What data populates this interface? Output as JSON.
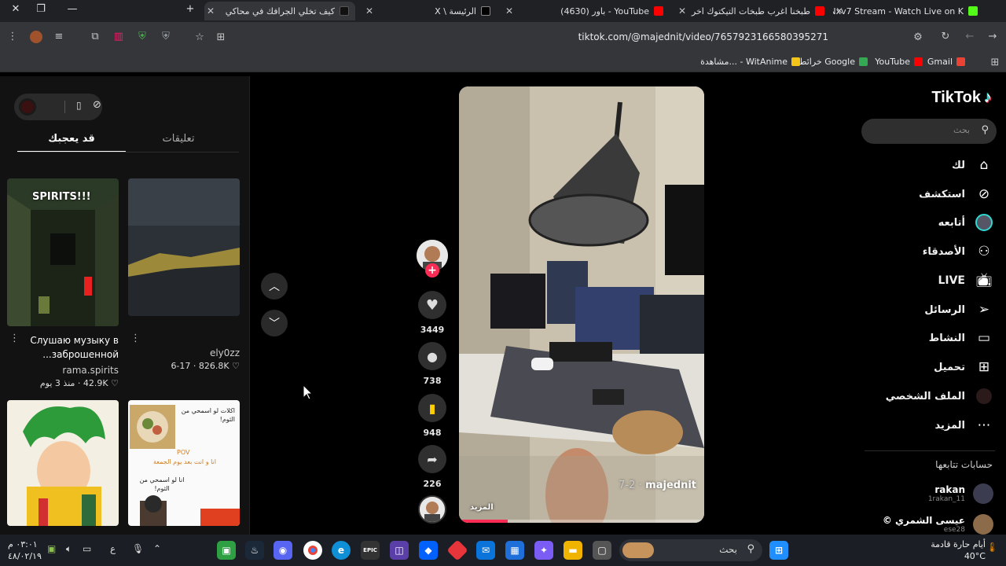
{
  "browser": {
    "tabs": [
      {
        "title": "Nxv7 Stream - Watch Live on K",
        "color": "#53fc18"
      },
      {
        "title": "طبخنا اغرب طبخات التيكتوك اخر",
        "color": "#ff0000"
      },
      {
        "title": "YouTube - باور (4630)",
        "color": "#ff0000"
      },
      {
        "title": "الرئيسة \\ X",
        "color": "#ffffff"
      },
      {
        "title": "كيف تخلي الجرافك في محاكي",
        "color": "#111111"
      }
    ],
    "url": "tiktok.com/@majednit/video/7657923166580395271",
    "bookmarks": [
      {
        "label": "Gmail",
        "color": "#ea4335"
      },
      {
        "label": "YouTube",
        "color": "#ff0000"
      },
      {
        "label": "خرائط Google",
        "color": "#34a853"
      },
      {
        "label": "مشاهدة... - WitAnime",
        "color": "#f5c518"
      }
    ]
  },
  "tiktok": {
    "logo": "TikTok",
    "search_placeholder": "بحث",
    "nav": [
      {
        "label": "لك",
        "icon": "home-icon"
      },
      {
        "label": "استكشف",
        "icon": "compass-icon"
      },
      {
        "label": "أتابعه",
        "icon": "following-avatar-icon"
      },
      {
        "label": "الأصدقاء",
        "icon": "friends-icon"
      },
      {
        "label": "LIVE",
        "icon": "live-tv-icon"
      },
      {
        "label": "الرسائل",
        "icon": "send-icon"
      },
      {
        "label": "النشاط",
        "icon": "activity-icon"
      },
      {
        "label": "تحميل",
        "icon": "upload-plus-icon"
      },
      {
        "label": "الملف الشخصي",
        "icon": "profile-avatar-icon"
      },
      {
        "label": "المزيد",
        "icon": "more-dots-icon"
      }
    ],
    "following_title": "حسابات تتابعها",
    "following": [
      {
        "name": "rakan",
        "handle": "1rakan_11"
      },
      {
        "name": "عيسى الشمري ©",
        "handle": "ese28"
      }
    ],
    "video": {
      "author": "majednit",
      "date": "7-2",
      "more_label": "المزيد",
      "progress": 0.2
    },
    "actions": {
      "likes": "3449",
      "comments": "738",
      "saves": "948",
      "shares": "226"
    },
    "side_panel": {
      "tab_comments": "تعليقات",
      "tab_suggested": "قد يعجبك",
      "items": [
        {
          "overlay_text": "SPIRITS!!!",
          "caption": "Слушаю музыку в заброшенной...",
          "author": "rama.spirits",
          "likes": "42.9K",
          "age": "منذ 3 يوم"
        },
        {
          "overlay_text": "",
          "caption": "",
          "author": "ely0zz",
          "likes": "826.8K",
          "age": "6-17"
        },
        {
          "overlay_text": "",
          "caption": "",
          "author": "",
          "likes": "",
          "age": ""
        },
        {
          "overlay_text": "انا و انت بعد يوم الجمعة",
          "caption": "",
          "author": "",
          "likes": "",
          "age": ""
        }
      ],
      "menu_texts": [
        "اكلات لو اسمحي من الثوم!",
        "POV",
        "انا و انت بعد يوم الجمعة",
        "انا لو اسمحي من الثوم!"
      ]
    }
  },
  "taskbar": {
    "search_label": "بحث",
    "weather_line1": "أيام حارة قادمة",
    "weather_line2": "40°C",
    "time": "٠٣:٠١ م",
    "date": "٤٨/٠٢/١٩",
    "lang": "ع"
  }
}
